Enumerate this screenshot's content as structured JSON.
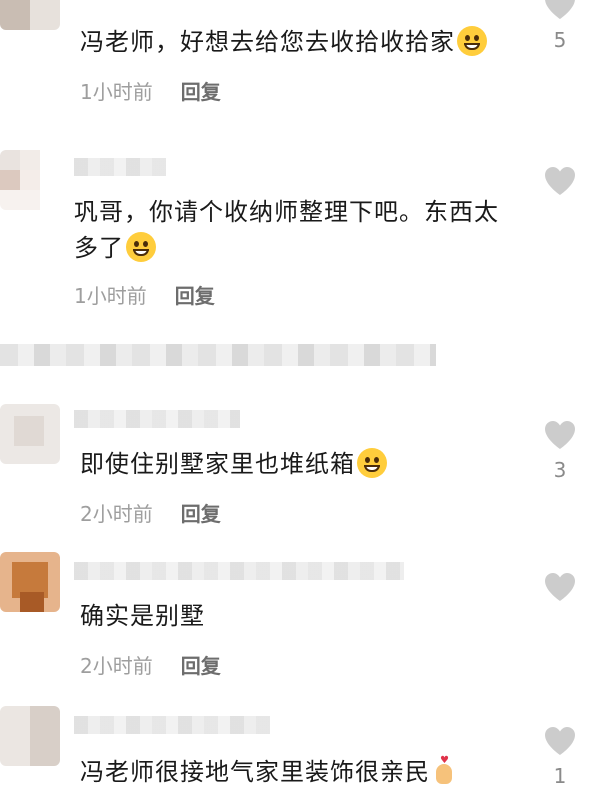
{
  "comments": [
    {
      "text": "冯老师，好想去给您去收拾收拾家",
      "time": "1小时前",
      "reply_label": "回复",
      "likes": "5",
      "emoji": "smirk-face-icon"
    },
    {
      "text": "巩哥，你请个收纳师整理下吧。东西太多了",
      "time": "1小时前",
      "reply_label": "回复",
      "likes": "",
      "emoji": "rofl-face-icon"
    },
    {
      "text": "即使住别墅家里也堆纸箱",
      "time": "2小时前",
      "reply_label": "回复",
      "likes": "3",
      "emoji": "grin-face-icon"
    },
    {
      "text": "确实是别墅",
      "time": "2小时前",
      "reply_label": "回复",
      "likes": "",
      "emoji": ""
    },
    {
      "text": "冯老师很接地气家里装饰很亲民",
      "time": "",
      "reply_label": "",
      "likes": "1",
      "emoji": "finger-heart-icon"
    }
  ],
  "colors": {
    "text": "#1a1a1a",
    "meta": "#9e9e9e",
    "reply": "#6d6d6d",
    "heart": "#cccccc",
    "emoji": "#ffcd3c"
  }
}
